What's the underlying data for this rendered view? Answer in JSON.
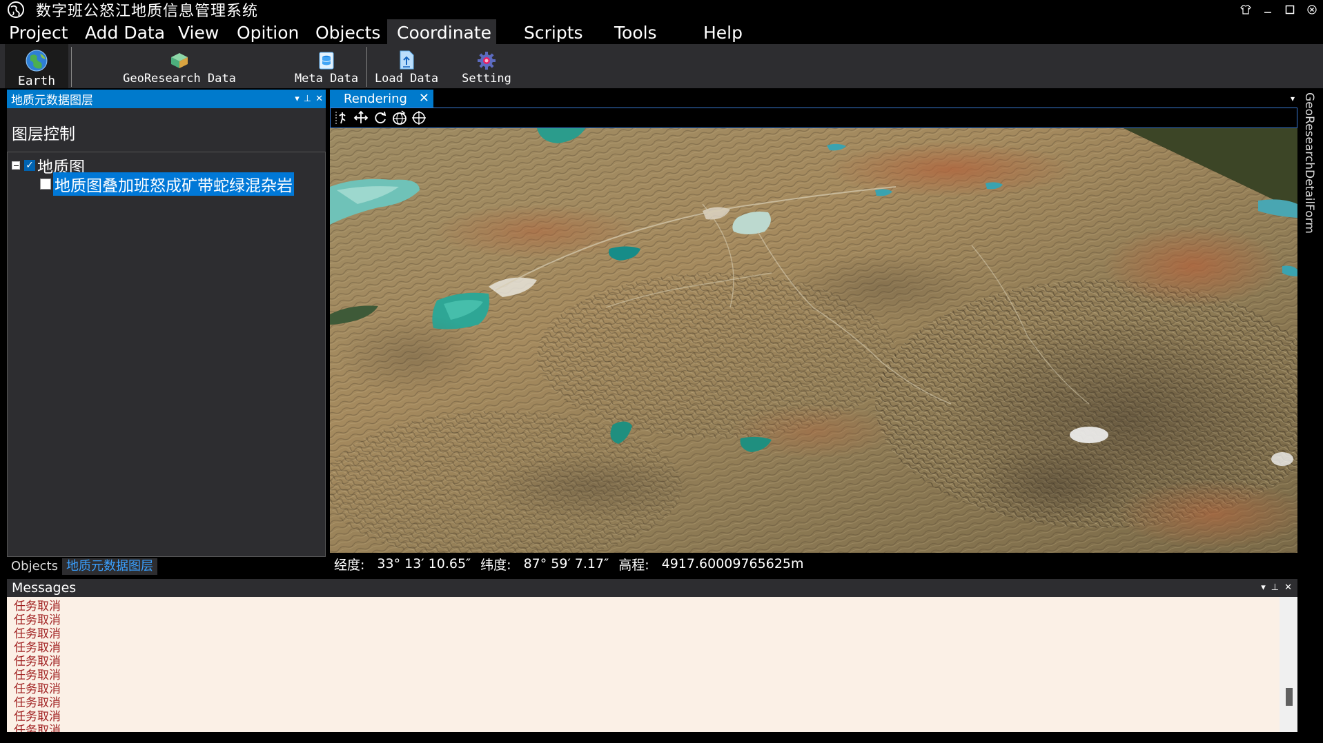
{
  "app": {
    "title": "数字班公怒江地质信息管理系统",
    "logo_icon": "globe-logo-icon"
  },
  "window_controls": [
    "shirt-icon",
    "minimize-icon",
    "maximize-icon",
    "close-icon"
  ],
  "menu": {
    "items": [
      {
        "label": "Project"
      },
      {
        "label": "Add Data"
      },
      {
        "label": "View"
      },
      {
        "label": "Opition"
      },
      {
        "label": "Objects"
      },
      {
        "label": "Coordinate",
        "active": true
      },
      {
        "label": "Scripts"
      },
      {
        "label": "Tools"
      },
      {
        "label": "Help"
      }
    ]
  },
  "toolbar": {
    "earth": "Earth",
    "georesearch": "GeoResearch Data",
    "metadata": "Meta Data",
    "loaddata": "Load Data",
    "setting": "Setting"
  },
  "left_panel": {
    "header": "地质元数据图层",
    "section_title": "图层控制",
    "tree": [
      {
        "label": "地质图",
        "checked": true,
        "expanded": true
      },
      {
        "label": "地质图叠加班怒成矿带蛇绿混杂岩",
        "checked": false,
        "selected": true
      }
    ],
    "tabs": [
      {
        "label": "Objects"
      },
      {
        "label": "地质元数据图层",
        "active": true
      }
    ]
  },
  "document": {
    "tab_label": "Rendering",
    "nav_icons": [
      "pan-icon",
      "move-icon",
      "rotate-icon",
      "globe-rotate-icon",
      "target-icon"
    ]
  },
  "status": {
    "lon_label": "经度:",
    "lon_value": "33° 13′ 10.65″",
    "lat_label": "纬度:",
    "lat_value": "87° 59′ 7.17″",
    "elev_label": "高程:",
    "elev_value": "4917.60009765625m"
  },
  "right_rail": {
    "label": "GeoResearchDetailForm"
  },
  "messages": {
    "header": "Messages",
    "lines": [
      "任务取消",
      "任务取消",
      "任务取消",
      "任务取消",
      "任务取消",
      "任务取消",
      "任务取消",
      "任务取消",
      "任务取消",
      "任务取消"
    ]
  },
  "colors": {
    "accent": "#007acc",
    "panel_bg": "#2d2d30",
    "message_bg": "#fbf0e6",
    "message_text": "#a02020"
  }
}
